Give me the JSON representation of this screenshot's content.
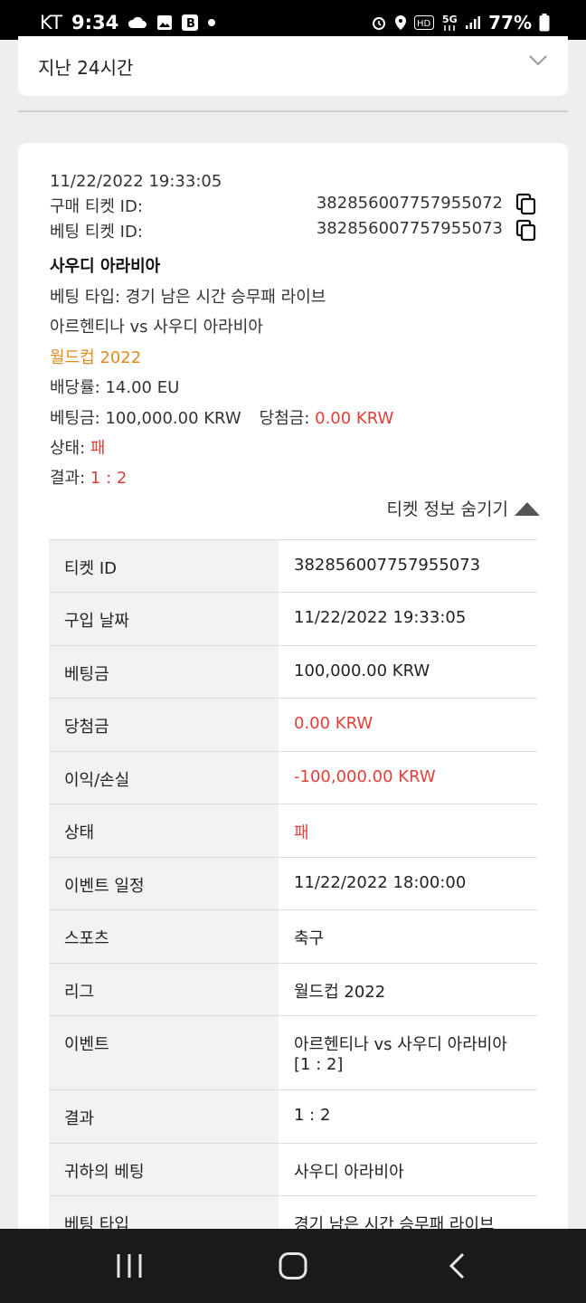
{
  "status_bar": {
    "carrier": "KT",
    "time": "9:34",
    "battery": "77%",
    "icons": [
      "cloud-icon",
      "gallery-icon",
      "b-app-icon",
      "dot-icon",
      "alarm-icon",
      "location-icon",
      "hd-icon",
      "5g-icon",
      "signal-icon",
      "battery-icon"
    ]
  },
  "filter": {
    "selected": "지난 24시간",
    "icon": "chevron-down-icon"
  },
  "ticket": {
    "datetime": "11/22/2022 19:33:05",
    "purchase_id_label": "구매 티켓 ID:",
    "purchase_id": "382856007757955072",
    "bet_id_label": "베팅 티켓 ID:",
    "bet_id": "382856007757955073",
    "selection": "사우디 아라비아",
    "bet_type_line": "베팅 타입: 경기 남은 시간 승무패 라이브",
    "match": "아르헨티나 vs 사우디 아라비아",
    "league": "월드컵 2022",
    "odds_line": "배당률: 14.00 EU",
    "stake_line": "베팅금: 100,000.00 KRW",
    "win_label": "당첨금:",
    "win_value": "0.00 KRW",
    "status_label": "상태:",
    "status_value": "패",
    "result_label": "결과:",
    "result_value": "1 : 2",
    "hide_label": "티켓 정보 숨기기",
    "accent_orange": "#e08a1e",
    "accent_red": "#e0403a"
  },
  "details": [
    {
      "key": "티켓 ID",
      "value": "382856007757955073"
    },
    {
      "key": "구입 날짜",
      "value": "11/22/2022 19:33:05"
    },
    {
      "key": "베팅금",
      "value": "100,000.00 KRW"
    },
    {
      "key": "당첨금",
      "value": "0.00 KRW"
    },
    {
      "key": "이익/손실",
      "value": "-100,000.00 KRW"
    },
    {
      "key": "상태",
      "value": "패"
    },
    {
      "key": "이벤트 일정",
      "value": "11/22/2022 18:00:00"
    },
    {
      "key": "스포츠",
      "value": "축구"
    },
    {
      "key": "리그",
      "value": "월드컵 2022"
    },
    {
      "key": "이벤트",
      "value": "아르헨티나 vs 사우디 아라비아",
      "value2": "[1 : 2]"
    },
    {
      "key": "결과",
      "value": "1 : 2"
    },
    {
      "key": "귀하의 베팅",
      "value": "사우디 아라비아"
    },
    {
      "key": "베팅 타입",
      "value": "경기 남은 시간 승무패 라이브"
    }
  ],
  "nav": {
    "icons": [
      "recent-apps-icon",
      "home-icon",
      "back-icon"
    ]
  }
}
